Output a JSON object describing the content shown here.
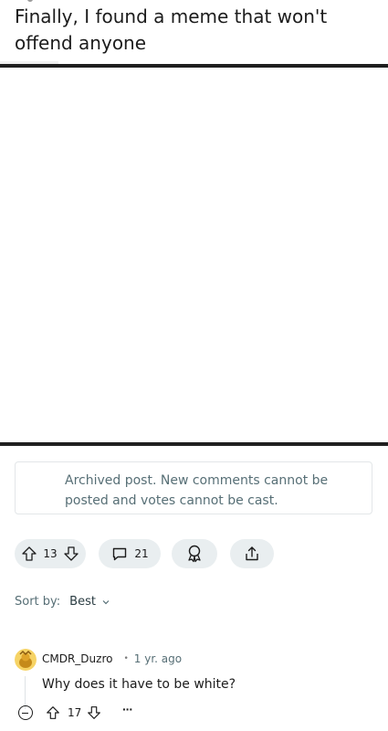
{
  "post": {
    "title": "Finally, I found a meme that won't offend anyone"
  },
  "archived_notice": "Archived post. New comments cannot be posted and votes cannot be cast.",
  "actions": {
    "score": "13",
    "comments": "21",
    "icons": [
      "upvote-icon",
      "downvote-icon",
      "comment-icon",
      "award-icon",
      "share-icon"
    ]
  },
  "sort": {
    "label": "Sort by:",
    "value": "Best"
  },
  "comments": [
    {
      "author": "CMDR_Duzro",
      "separator": "•",
      "age": "1 yr. ago",
      "body": "Why does it have to be white?",
      "score": "17",
      "more": "···"
    }
  ],
  "colors": {
    "pill_bg": "#e9eef0",
    "muted_text": "#576f76",
    "image_border": "#1f1f1f"
  }
}
